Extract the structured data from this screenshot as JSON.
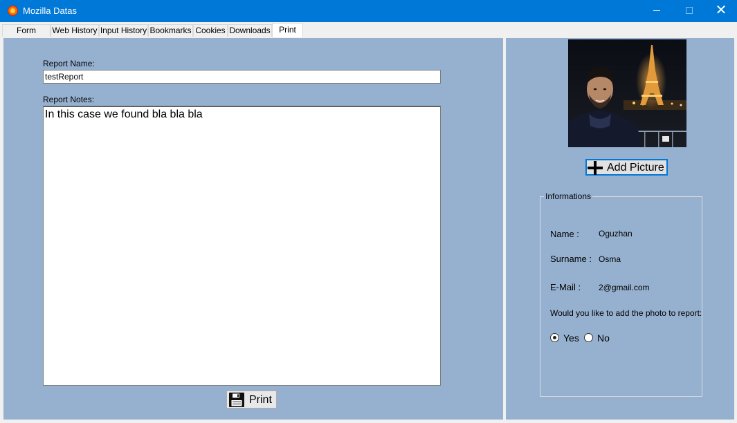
{
  "window": {
    "title": "Mozilla Datas"
  },
  "tabs": [
    {
      "label": "Form History"
    },
    {
      "label": "Web History"
    },
    {
      "label": "Input History"
    },
    {
      "label": "Bookmarks"
    },
    {
      "label": "Cookies"
    },
    {
      "label": "Downloads"
    },
    {
      "label": "Print",
      "active": true
    }
  ],
  "report": {
    "name_label": "Report Name:",
    "name_value": "testReport",
    "notes_label": "Report Notes:",
    "notes_value": "In this case we found bla bla bla",
    "print_label": "Print"
  },
  "picture": {
    "add_label": "Add Picture"
  },
  "informations": {
    "legend": "Informations",
    "name_label": "Name :",
    "name_value": "Oguzhan",
    "surname_label": "Surname :",
    "surname_value": "Osma",
    "email_label": "E-Mail :",
    "email_value": "2@gmail.com",
    "question": "Would you like to add the photo to report:",
    "options": [
      {
        "label": "Yes",
        "checked": true
      },
      {
        "label": "No",
        "checked": false
      }
    ]
  },
  "colors": {
    "titlebar": "#0078d7",
    "panel": "#96b1d0",
    "focus_border": "#0078d7"
  }
}
